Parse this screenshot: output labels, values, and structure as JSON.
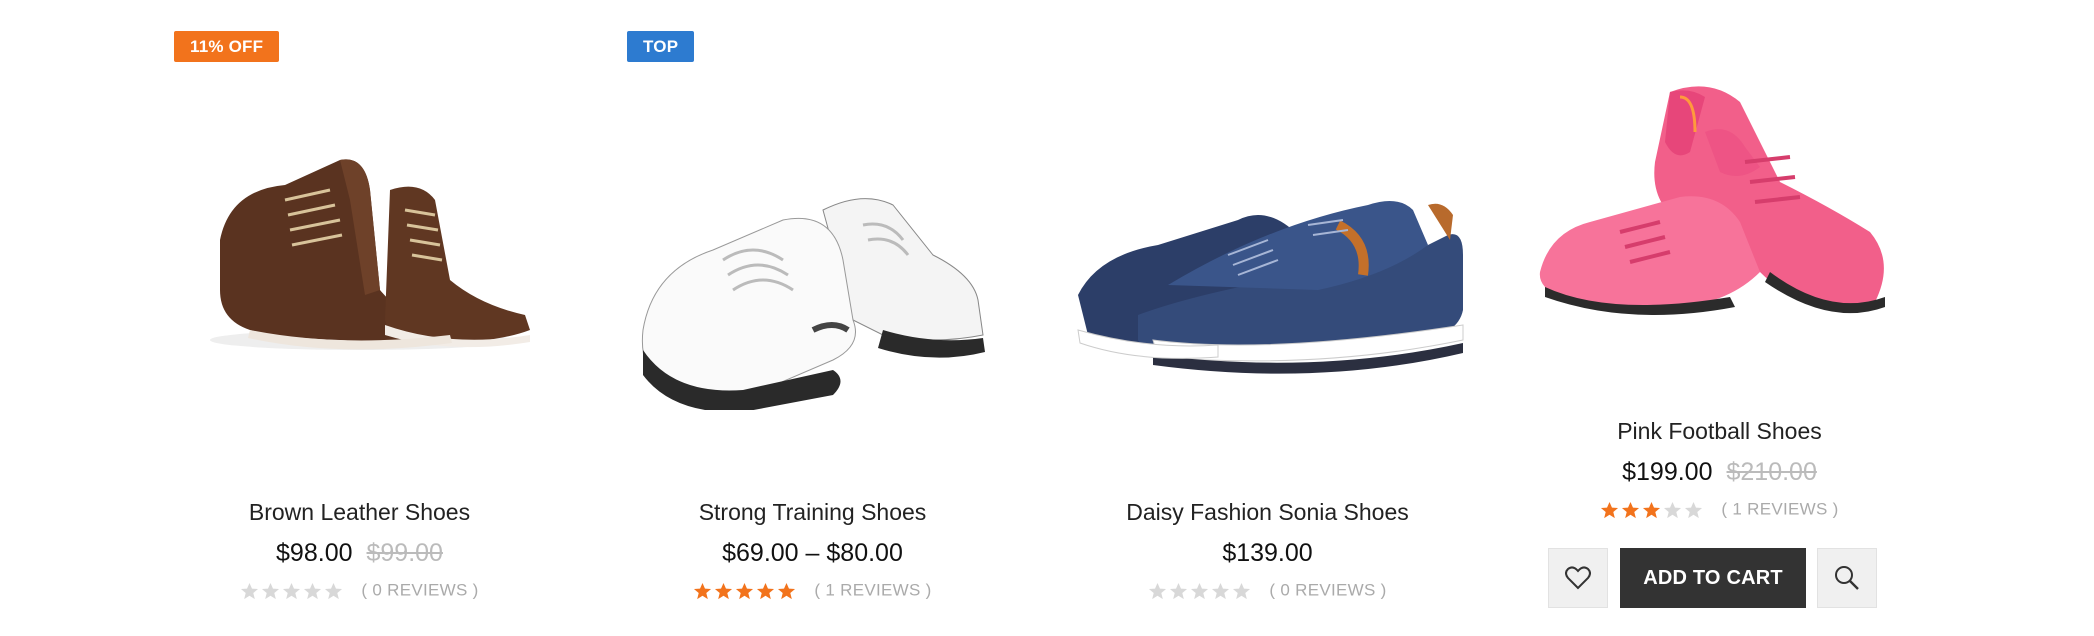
{
  "colors": {
    "badge_off": "#f2731c",
    "badge_top": "#2d7bd0",
    "star_filled": "#f2731c",
    "star_empty": "#d8d8d8",
    "cart_button": "#333333"
  },
  "products": [
    {
      "badge": "11% OFF",
      "name": "Brown Leather Shoes",
      "price": "$98.00",
      "old_price": "$99.00",
      "rating": 0,
      "reviews": "( 0 REVIEWS )"
    },
    {
      "badge": "TOP",
      "name": "Strong Training Shoes",
      "price": "$69.00 – $80.00",
      "old_price": "",
      "rating": 5,
      "reviews": "( 1 REVIEWS )"
    },
    {
      "badge": "",
      "name": "Daisy Fashion Sonia Shoes",
      "price": "$139.00",
      "old_price": "",
      "rating": 0,
      "reviews": "( 0 REVIEWS )"
    },
    {
      "badge": "",
      "name": "Pink Football Shoes",
      "price": "$199.00",
      "old_price": "$210.00",
      "rating": 3,
      "reviews": "( 1 REVIEWS )",
      "actions": {
        "wishlist_icon": "heart-icon",
        "add_to_cart": "ADD TO CART",
        "quick_view_icon": "search-icon"
      }
    }
  ]
}
